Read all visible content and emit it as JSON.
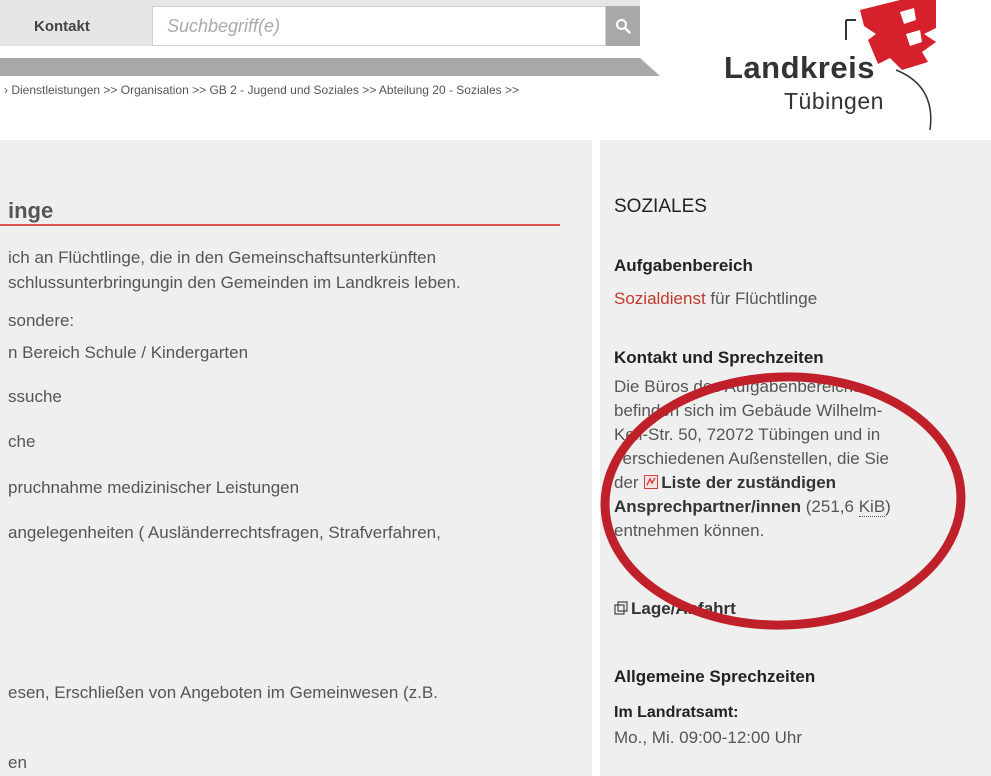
{
  "header": {
    "kontakt_label": "Kontakt",
    "search_placeholder": "Suchbegriff(e)",
    "breadcrumb": "› Dienstleistungen >> Organisation >> GB 2 - Jugend und Soziales >> Abteilung 20 - Soziales >>"
  },
  "logo": {
    "line1": "Landkreis",
    "line2": "Tübingen"
  },
  "main": {
    "title": "inge",
    "lines": [
      "ich an Flüchtlinge, die in den Gemeinschaftsunterkünften",
      "schlussunterbringungin den Gemeinden im Landkreis leben.",
      "sondere:",
      "n Bereich Schule / Kindergarten",
      "ssuche",
      "che",
      "pruchnahme medizinischer Leistungen",
      "angelegenheiten ( Ausländerrechtsfragen, Strafverfahren,",
      "esen, Erschließen von Angeboten im Gemeinwesen (z.B.",
      "en"
    ]
  },
  "sidebar": {
    "title": "SOZIALES",
    "aufgaben_heading": "Aufgabenbereich",
    "aufgaben_link": "Sozialdienst",
    "aufgaben_rest": " für Flüchtlinge",
    "kontakt_heading": "Kontakt und Sprechzeiten",
    "kontakt_lines": [
      "Die Büros des Aufgabenbereichs",
      "befinden sich im Gebäude Wilhelm-",
      "Keil-Str. 50, 72072 Tübingen und in",
      "verschiedenen Außenstellen, die Sie"
    ],
    "kontakt_der": "der ",
    "liste_link_1": "Liste der zuständigen",
    "liste_link_2": "Ansprechpartner/innen",
    "filesize_prefix": " (251,6 ",
    "filesize_unit": "KiB",
    "filesize_suffix": ")",
    "kontakt_end": "entnehmen können.",
    "lage_link": "Lage/Anfahrt",
    "sprech_heading": "Allgemeine Sprechzeiten",
    "landratsamt_label": "Im Landratsamt:",
    "hours": "Mo., Mi. 09:00-12:00 Uhr"
  },
  "colors": {
    "accent_red": "#c0392b",
    "annotation_red": "#c0202a"
  }
}
